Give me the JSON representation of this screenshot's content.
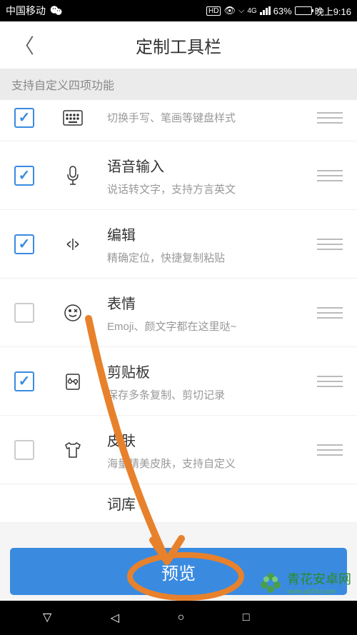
{
  "statusBar": {
    "carrier": "中国移动",
    "hd": "HD",
    "network": "4G",
    "battery": "63%",
    "time": "晚上9:16"
  },
  "header": {
    "title": "定制工具栏"
  },
  "notice": "支持自定义四项功能",
  "items": [
    {
      "checked": true,
      "title": "",
      "desc": "切换手写、笔画等键盘样式"
    },
    {
      "checked": true,
      "title": "语音输入",
      "desc": "说话转文字，支持方言英文"
    },
    {
      "checked": true,
      "title": "编辑",
      "desc": "精确定位，快捷复制粘贴"
    },
    {
      "checked": false,
      "title": "表情",
      "desc": "Emoji、颜文字都在这里哒~"
    },
    {
      "checked": true,
      "title": "剪贴板",
      "desc": "保存多条复制、剪切记录"
    },
    {
      "checked": false,
      "title": "皮肤",
      "desc": "海量精美皮肤，支持自定义"
    },
    {
      "checked": false,
      "title": "词库",
      "desc": ""
    }
  ],
  "previewButton": "预览",
  "watermark": "青花安卓网",
  "watermarkUrl": "www.qhhlv.com"
}
